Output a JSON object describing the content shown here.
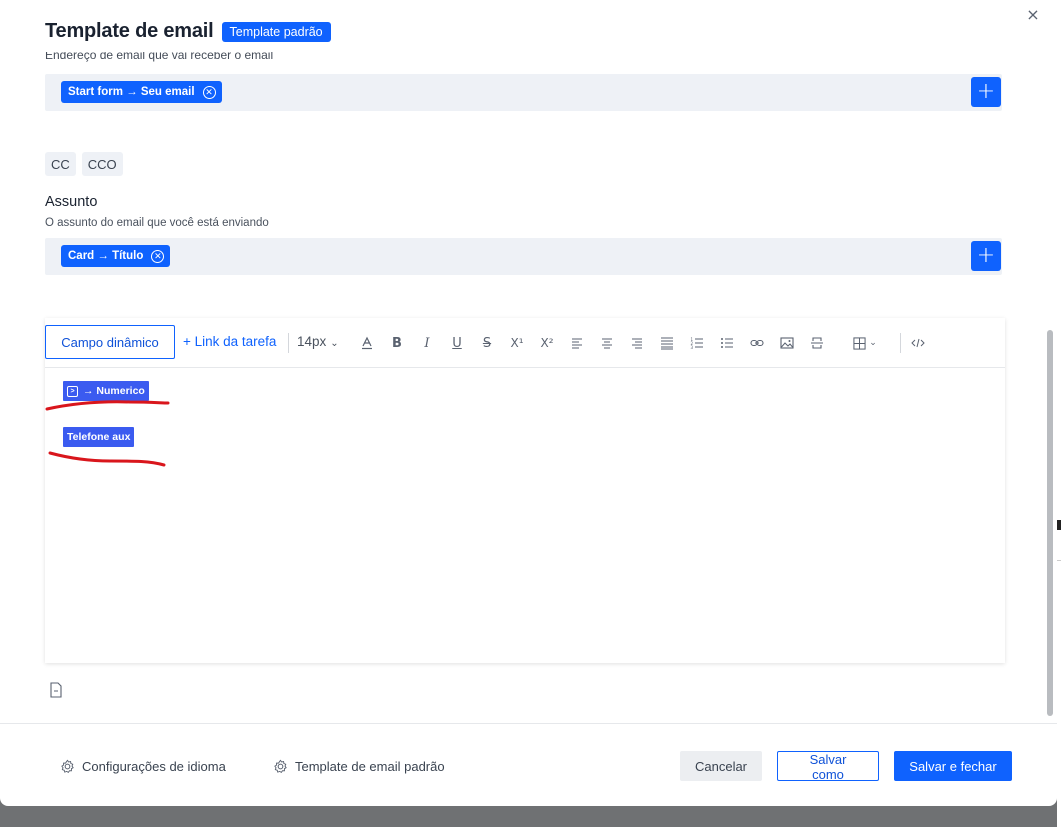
{
  "modal": {
    "title": "Template de email",
    "badge": "Template padrão",
    "close": "×"
  },
  "recipient": {
    "helper_cut": "Endereço de email que vai receber o email",
    "chip": "Start form → Seu email",
    "add": "+"
  },
  "cc_buttons": {
    "cc": "CC",
    "cco": "CCO"
  },
  "subject": {
    "label": "Assunto",
    "helper": "O assunto do email que você está enviando",
    "chip": "Card → Título",
    "add": "+"
  },
  "toolbar": {
    "campo_dinamico": "Campo dinâmico",
    "link_tarefa": "+ Link da tarefa",
    "font_size": "14px",
    "superscript": "X¹",
    "subscript": "X²"
  },
  "editor_content": {
    "tag1": "→ Numerico",
    "tag2": "Telefone aux"
  },
  "footer": {
    "language_config": "Configurações de idioma",
    "default_template": "Template de email padrão",
    "cancel": "Cancelar",
    "save_as": "Salvar como",
    "save_close": "Salvar e fechar"
  },
  "colors": {
    "primary": "#0f62fe",
    "tag": "#3b5bf0",
    "annotation": "#d9161c",
    "field_bg": "#eef1f6"
  }
}
